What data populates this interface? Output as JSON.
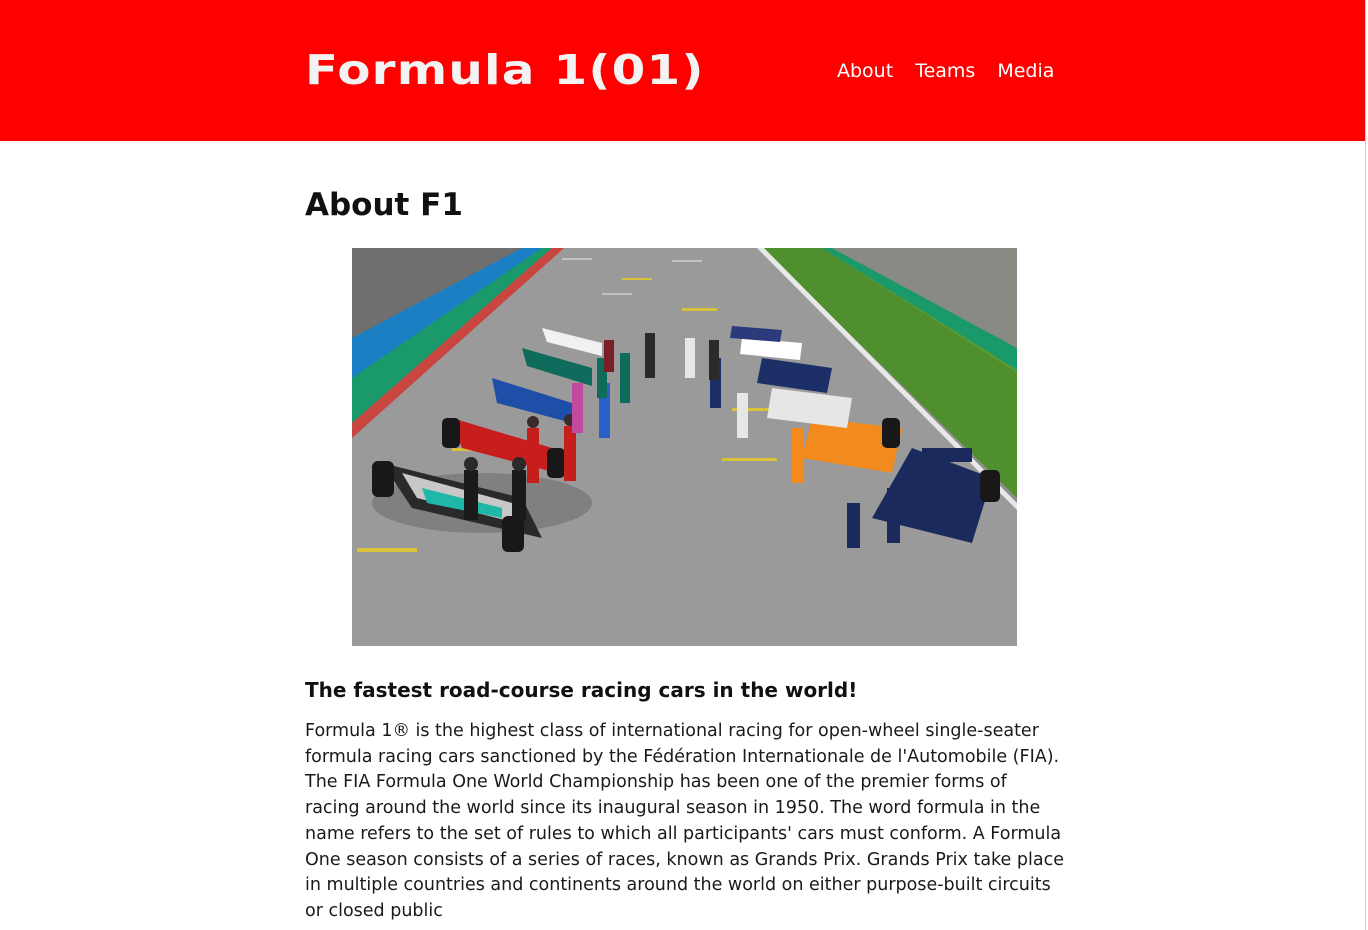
{
  "header": {
    "logo": "Formula 1(01)",
    "nav": [
      "About",
      "Teams",
      "Media"
    ]
  },
  "main": {
    "title": "About F1",
    "image_alt": "Formula 1 drivers posing with their cars on the grid",
    "subtitle": "The fastest road-course racing cars in the world!",
    "paragraph": "Formula 1® is the highest class of international racing for open-wheel single-seater formula racing cars sanctioned by the Fédération Internationale de l'Automobile (FIA). The FIA Formula One World Championship has been one of the premier forms of racing around the world since its inaugural season in 1950. The word formula in the name refers to the set of rules to which all participants' cars must conform. A Formula One season consists of a series of races, known as Grands Prix. Grands Prix take place in multiple countries and continents around the world on either purpose-built circuits or closed public"
  },
  "colors": {
    "header_bg": "#ff0000",
    "logo": "#f3f3f3",
    "nav_text": "#ffffff",
    "text": "#111111"
  }
}
